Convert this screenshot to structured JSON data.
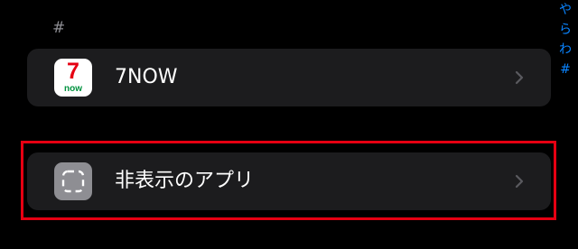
{
  "section_header": "#",
  "apps": [
    {
      "label": "7NOW",
      "icon": "7now-app-icon",
      "icon_text": {
        "top": "7",
        "bottom": "now"
      }
    }
  ],
  "hidden_apps": {
    "label": "非表示のアプリ",
    "icon": "dashed-square-icon"
  },
  "index_bar": [
    "や",
    "ら",
    "わ",
    "#"
  ],
  "colors": {
    "background": "#000000",
    "cell": "#1c1c1e",
    "secondary_text": "#8e8e93",
    "index_accent": "#0a84ff",
    "highlight": "#e60012"
  }
}
